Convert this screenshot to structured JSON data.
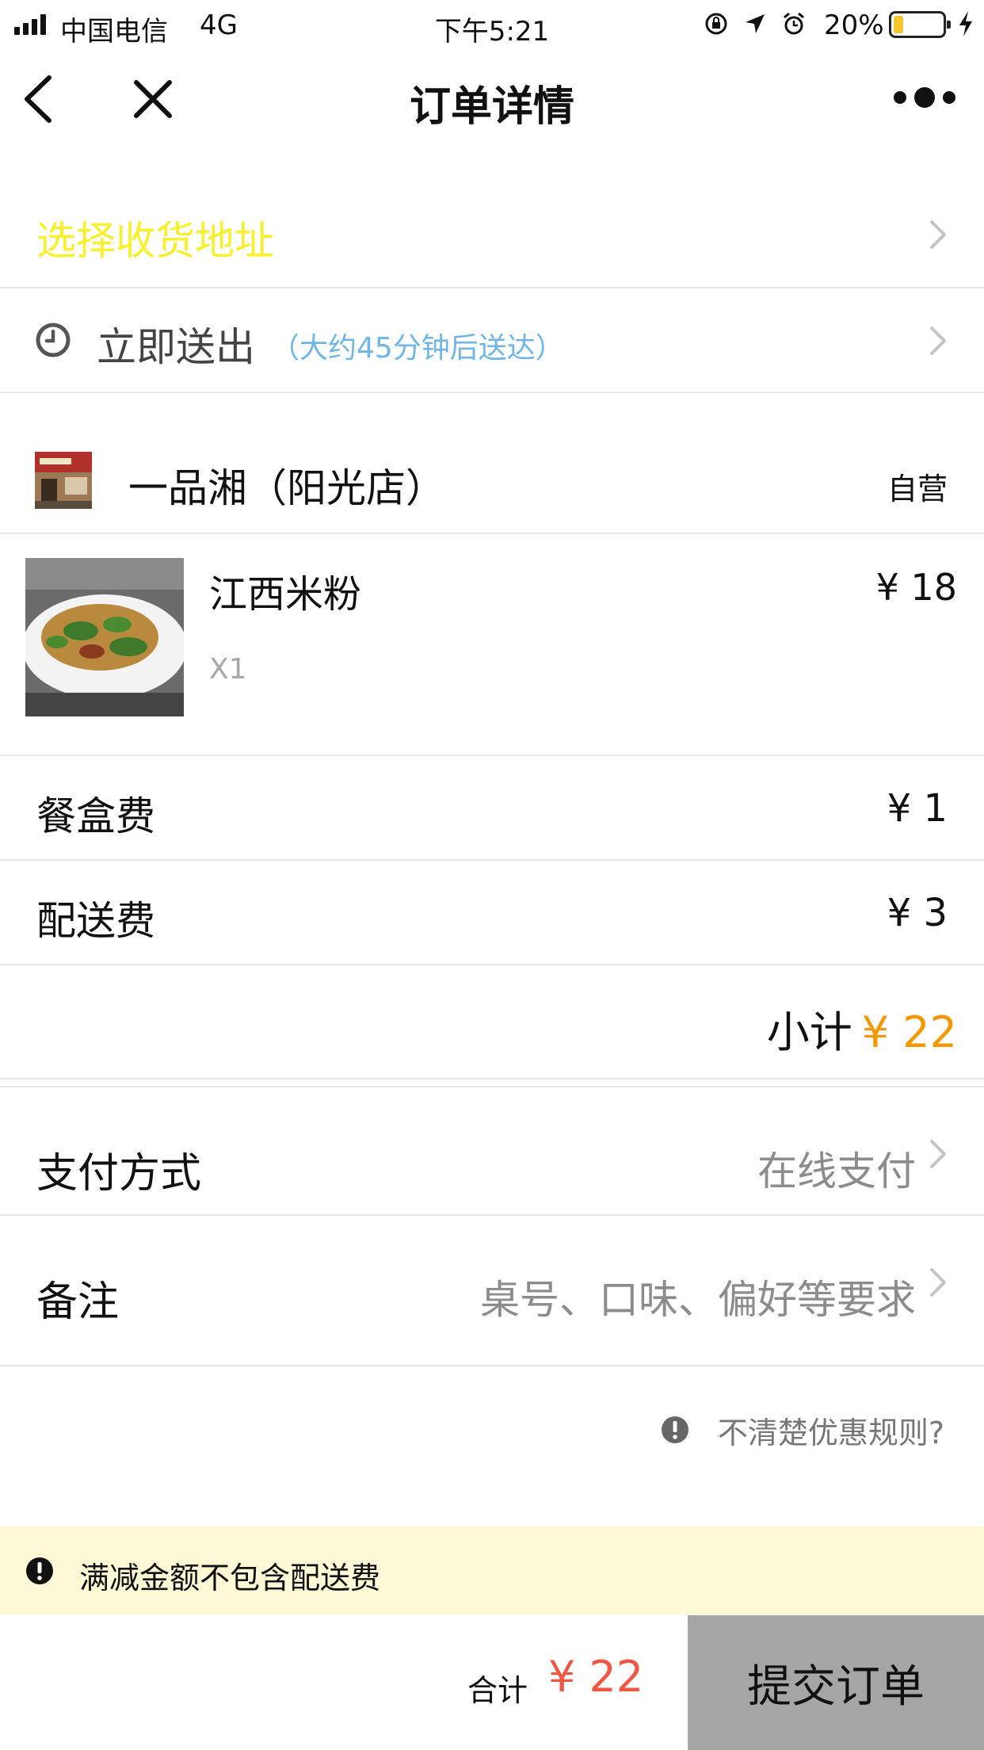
{
  "status_bar": {
    "carrier": "中国电信",
    "network": "4G",
    "time": "下午5:21",
    "battery_percent_label": "20%",
    "battery_level": 0.2,
    "icons": [
      "signal-icon",
      "orientation-lock-icon",
      "location-arrow-icon",
      "alarm-icon",
      "battery-icon",
      "charging-icon"
    ]
  },
  "nav": {
    "title": "订单详情",
    "icons": [
      "back-icon",
      "close-icon",
      "more-icon"
    ]
  },
  "address": {
    "label": "选择收货地址",
    "color": "#f7f02a"
  },
  "delivery": {
    "label": "立即送出",
    "note": "（大约45分钟后送达）",
    "note_color": "#6fb6e8"
  },
  "shop": {
    "name": "一品湘（阳光店）",
    "tag": "自营"
  },
  "items": [
    {
      "name": "江西米粉",
      "price": "¥ 18",
      "quantity": "X1"
    }
  ],
  "fees": {
    "box_label": "餐盒费",
    "box_value": "¥ 1",
    "delivery_label": "配送费",
    "delivery_value": "¥ 3"
  },
  "subtotal": {
    "label": "小计",
    "value": "¥ 22",
    "color": "#f39800"
  },
  "payment": {
    "label": "支付方式",
    "value": "在线支付"
  },
  "remark": {
    "label": "备注",
    "placeholder": "桌号、口味、偏好等要求"
  },
  "rules_link": {
    "text": "不清楚优惠规则?"
  },
  "notice": {
    "text": "满减金额不包含配送费",
    "background": "#fdf9d6"
  },
  "footer": {
    "total_label": "合计",
    "total_value": "¥ 22",
    "total_color": "#ef5743",
    "submit_label": "提交订单",
    "submit_background": "#a6a6a6"
  }
}
